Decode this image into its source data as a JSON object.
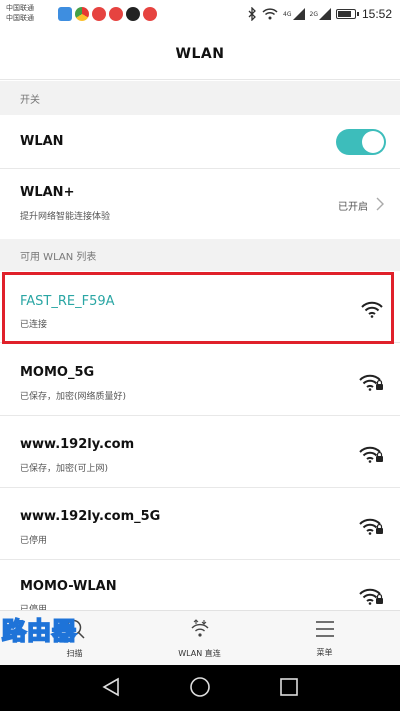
{
  "status_bar": {
    "carrier_1": "中国联通",
    "carrier_2": "中国联通",
    "net_top": "4G",
    "net_bottom": "2G",
    "time": "15:52"
  },
  "header": {
    "title": "WLAN"
  },
  "sections": {
    "switch_header": "开关",
    "list_header": "可用 WLAN 列表"
  },
  "wlan_toggle": {
    "label": "WLAN",
    "state": "on"
  },
  "wlan_plus": {
    "label": "WLAN+",
    "sublabel": "提升网络智能连接体验",
    "value": "已开启"
  },
  "networks": [
    {
      "ssid": "FAST_RE_F59A",
      "status": "已连接",
      "locked": false,
      "connected": true
    },
    {
      "ssid": "MOMO_5G",
      "status": "已保存，加密(网络质量好)",
      "locked": true,
      "connected": false
    },
    {
      "ssid": "www.192ly.com",
      "status": "已保存，加密(可上网)",
      "locked": true,
      "connected": false
    },
    {
      "ssid": "www.192ly.com_5G",
      "status": "已停用",
      "locked": true,
      "connected": false
    },
    {
      "ssid": "MOMO-WLAN",
      "status": "已停用",
      "locked": true,
      "connected": false
    }
  ],
  "toolbar": {
    "scan_label": "扫描",
    "direct_label": "WLAN 直连",
    "menu_label": "菜单"
  },
  "watermark": "路由器",
  "colors": {
    "accent": "#3dbdbb",
    "connected_text": "#2aa6a4",
    "highlight": "#e0202a"
  }
}
